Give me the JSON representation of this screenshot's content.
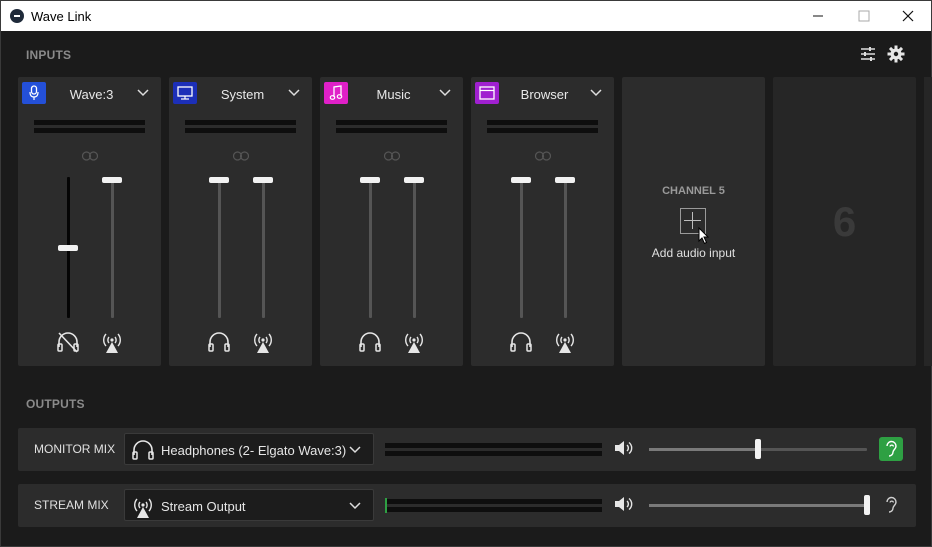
{
  "window": {
    "title": "Wave Link"
  },
  "inputs": {
    "section_label": "INPUTS",
    "channels": [
      {
        "name": "Wave:3",
        "icon": "microphone-icon",
        "color": "#2450d8",
        "monitor_level": 0.5,
        "stream_level": 1.0,
        "monitor_muted": true
      },
      {
        "name": "System",
        "icon": "monitor-icon",
        "color": "#1c2fb8",
        "monitor_level": 1.0,
        "stream_level": 1.0,
        "monitor_muted": false
      },
      {
        "name": "Music",
        "icon": "music-note-icon",
        "color": "#e020c8",
        "monitor_level": 1.0,
        "stream_level": 1.0,
        "monitor_muted": false
      },
      {
        "name": "Browser",
        "icon": "browser-window-icon",
        "color": "#a020d0",
        "monitor_level": 1.0,
        "stream_level": 1.0,
        "monitor_muted": false
      }
    ],
    "add_slot": {
      "label": "CHANNEL 5",
      "action": "Add audio input"
    },
    "next_slot_number": "6"
  },
  "outputs": {
    "section_label": "OUTPUTS",
    "mixes": [
      {
        "label": "MONITOR MIX",
        "device": "Headphones (2- Elgato Wave:3)",
        "device_icon": "headphones-icon",
        "volume": 0.5,
        "listening": true
      },
      {
        "label": "STREAM MIX",
        "device": "Stream Output",
        "device_icon": "broadcast-icon",
        "volume": 1.0,
        "listening": false
      }
    ]
  },
  "colors": {
    "accent_green": "#2ea043",
    "background": "#1b1b1b",
    "card": "#2c2c2c"
  }
}
